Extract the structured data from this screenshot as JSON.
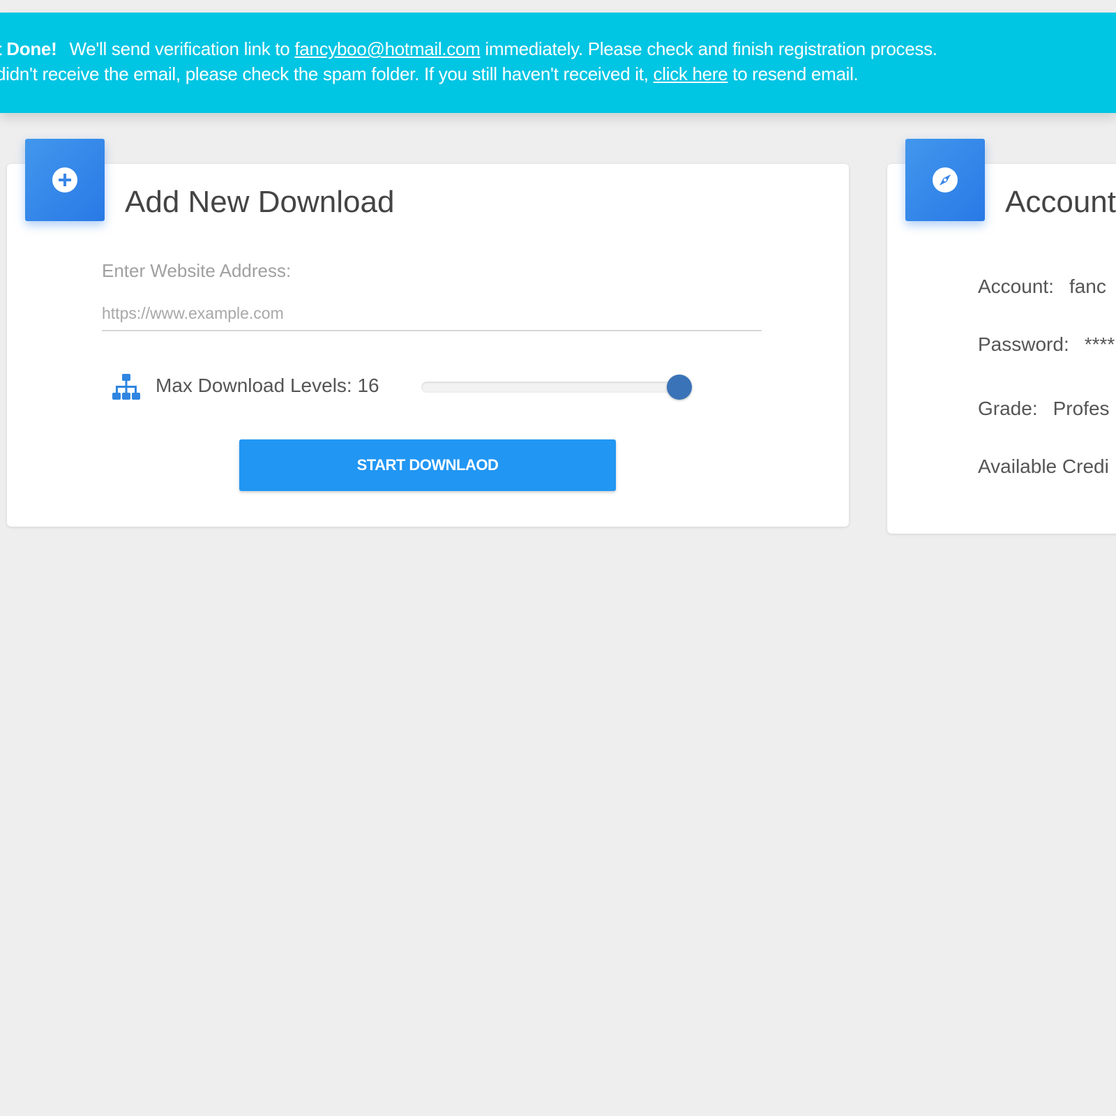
{
  "alert": {
    "title": "t Done!",
    "line1_before": "We'll send verification link to ",
    "email": "fancyboo@hotmail.com",
    "line1_after": " immediately. Please check and finish registration process.",
    "line2_before": "didn't receive the email, please check the spam folder. If you still haven't received it, ",
    "resend_link": "click here",
    "line2_after": " to resend email.",
    "color": "#00c5e3"
  },
  "download_card": {
    "icon": "plus-circle-icon",
    "title": "Add New Download",
    "url_label": "Enter Website Address:",
    "url_placeholder": "https://www.example.com",
    "url_value": "",
    "levels_icon": "sitemap-icon",
    "levels_label": "Max Download Levels: 16",
    "levels_fraction": 1.0,
    "start_button": "START DOWNLAOD",
    "accent": "#2196f3"
  },
  "account_card": {
    "icon": "compass-icon",
    "title": "Account",
    "rows": [
      {
        "key": "Account:",
        "value": "fanc"
      },
      {
        "key": "Password:",
        "value": "****"
      },
      {
        "key": "Grade:",
        "value": "Profes"
      },
      {
        "key": "Available Credi",
        "value": ""
      }
    ]
  }
}
